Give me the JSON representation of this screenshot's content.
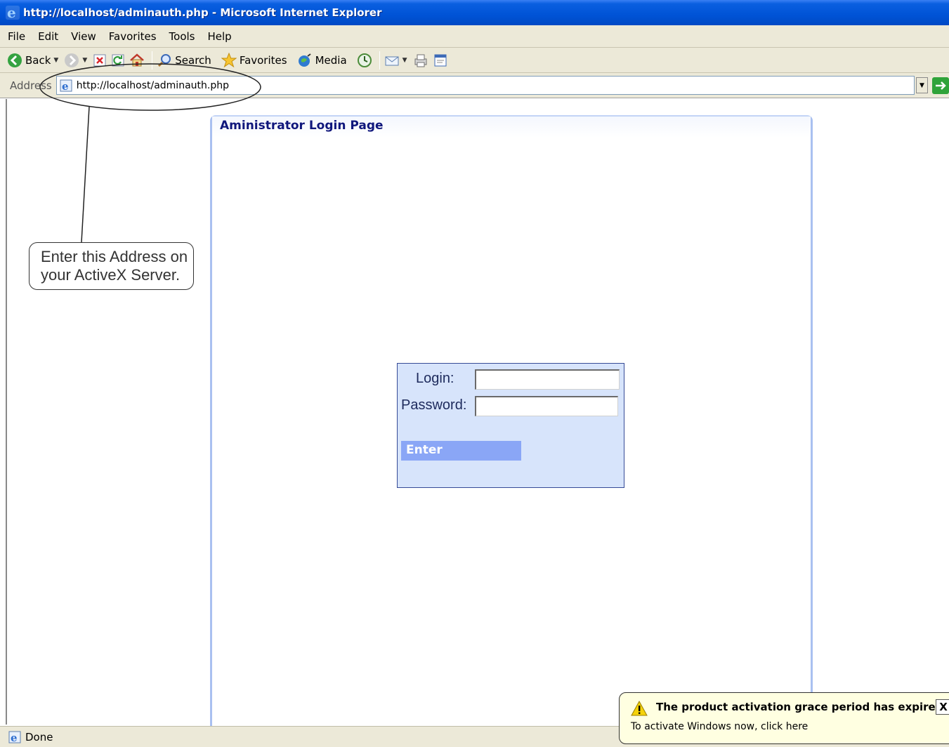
{
  "window": {
    "title": "http://localhost/adminauth.php - Microsoft Internet Explorer"
  },
  "menu": {
    "items": [
      "File",
      "Edit",
      "View",
      "Favorites",
      "Tools",
      "Help"
    ]
  },
  "toolbar": {
    "back_label": "Back",
    "search_label": "Search",
    "favorites_label": "Favorites",
    "media_label": "Media"
  },
  "address": {
    "label": "Address",
    "url": "http://localhost/adminauth.php"
  },
  "page": {
    "panel_title": "Aministrator Login Page",
    "login_label": "Login:",
    "password_label": "Password:",
    "login_value": "",
    "password_value": "",
    "enter_label": "Enter"
  },
  "callout": {
    "text_line1": "Enter this Address on",
    "text_line2": "your ActiveX Server."
  },
  "status": {
    "text": "Done"
  },
  "balloon": {
    "title": "The product activation grace period has expired",
    "text": "To activate Windows now, click here",
    "close": "X"
  },
  "colors": {
    "titlebar": "#0053d6",
    "chrome": "#ece9d8",
    "panel_border": "#a9c0f0",
    "login_box_bg": "#d7e4fb",
    "enter_button": "#8aa6f6",
    "panel_title": "#10177c",
    "balloon_bg": "#ffffe1"
  }
}
